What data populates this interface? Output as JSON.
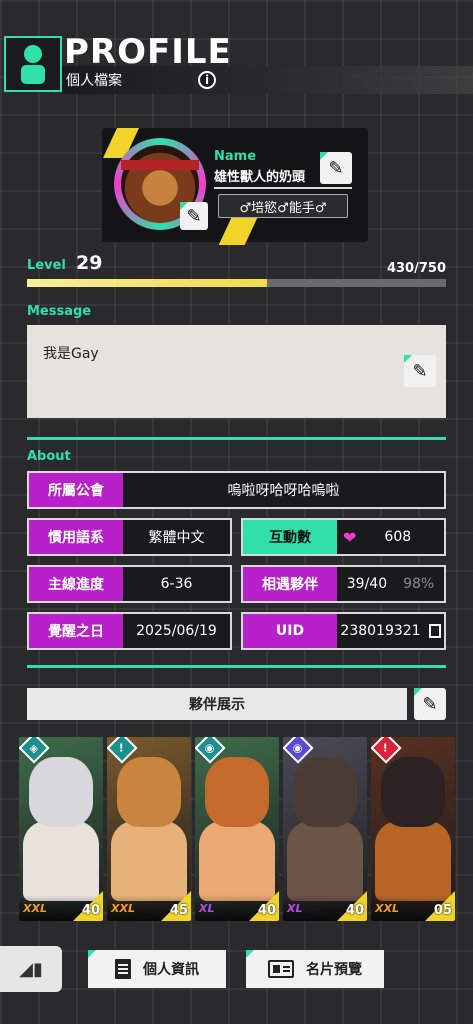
{
  "header": {
    "title": "PROFILE",
    "subtitle": "個人檔案",
    "info_icon_glyph": "i"
  },
  "card": {
    "name_label": "Name",
    "name_value": "雄性獸人的奶頭",
    "title_badge": "♂培慾♂能手♂",
    "edit_glyph": "✎"
  },
  "level": {
    "label": "Level",
    "value": "29",
    "xp_text": "430/750",
    "xp_current": 430,
    "xp_max": 750
  },
  "message": {
    "label": "Message",
    "text": "我是Gay"
  },
  "about": {
    "label": "About",
    "guild_label": "所屬公會",
    "guild_value": "嗚啦呀哈呀哈嗚啦",
    "language_label": "慣用語系",
    "language_value": "繁體中文",
    "interactions_label": "互動數",
    "interactions_value": "608",
    "progress_label": "主線進度",
    "progress_value": "6-36",
    "partners_label": "相遇夥伴",
    "partners_value": "39/40",
    "partners_percent": "98%",
    "awaken_label": "覺醒之日",
    "awaken_value": "2025/06/19",
    "uid_label": "UID",
    "uid_value": "238019321",
    "heart_glyph": "❤"
  },
  "showcase": {
    "label": "夥伴展示",
    "partners": [
      {
        "size": "XXL",
        "level": "40",
        "badge": "◈",
        "badge_color": "#1d8f8f",
        "bg": "#3e6d4a",
        "fur": "#d8d8dc",
        "skin": "#e9e2dc",
        "size_color": "#f39a2a"
      },
      {
        "size": "XXL",
        "level": "45",
        "badge": "!",
        "badge_color": "#1d8f8f",
        "bg": "#7a5a2c",
        "fur": "#c9843e",
        "skin": "#e7b27a",
        "size_color": "#f39a2a"
      },
      {
        "size": "XL",
        "level": "40",
        "badge": "◉",
        "badge_color": "#1d8f8f",
        "bg": "#3e6d4a",
        "fur": "#c56a2a",
        "skin": "#e9a874",
        "size_color": "#b64de0"
      },
      {
        "size": "XL",
        "level": "40",
        "badge": "◉",
        "badge_color": "#5a4ad8",
        "bg": "#4c4c58",
        "fur": "#4a3b34",
        "skin": "#6b5448",
        "size_color": "#b64de0"
      },
      {
        "size": "XXL",
        "level": "05",
        "badge": "!",
        "badge_color": "#d8233a",
        "bg": "#5a3020",
        "fur": "#2c2222",
        "skin": "#b86628",
        "size_color": "#f39a2a"
      }
    ]
  },
  "bottom": {
    "back_glyph": "◢▮",
    "profile_info": "個人資訊",
    "card_preview": "名片預覽"
  },
  "colors": {
    "accent": "#2fe0a8",
    "magenta": "#b821c9",
    "yellow": "#f1d42a"
  }
}
